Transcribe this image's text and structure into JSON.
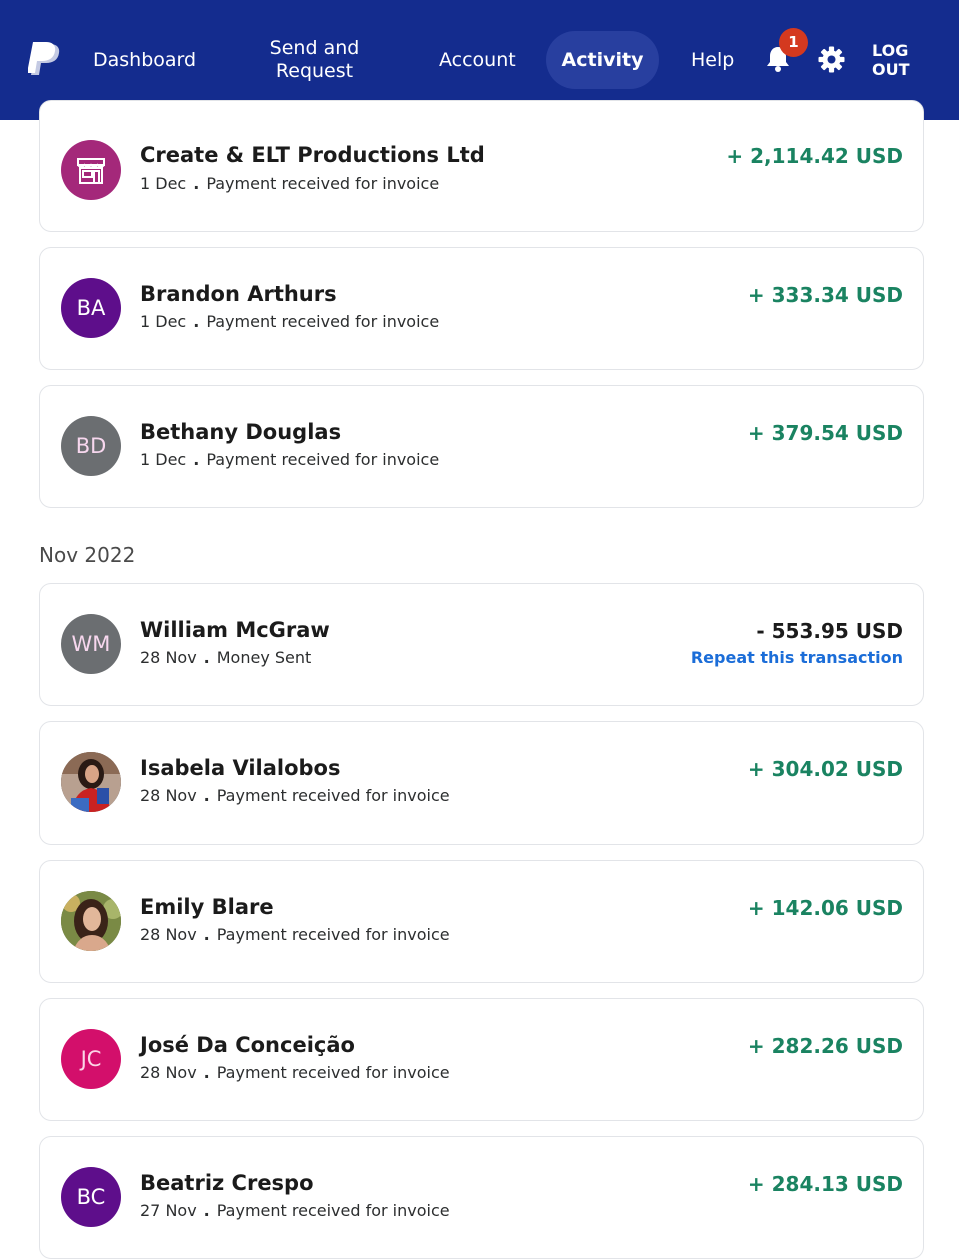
{
  "nav": {
    "dashboard": "Dashboard",
    "send_line1": "Send and",
    "send_line2": "Request",
    "account": "Account",
    "activity": "Activity",
    "help": "Help",
    "notification_count": "1",
    "logout_line1": "LOG",
    "logout_line2": "OUT"
  },
  "colors": {
    "header": "#142c8e",
    "active_tab": "#283f9f",
    "positive_amount": "#1a8361",
    "link": "#1b6dd8",
    "badge": "#d4391f"
  },
  "month_label": "Nov 2022",
  "transactions": [
    {
      "name": "Create & ELT Productions Ltd",
      "date": "1 Dec",
      "description": "Payment received for invoice",
      "amount": "+ 2,114.42 USD",
      "avatar_icon": "storefront-icon",
      "avatar_color": "#a4287a"
    },
    {
      "name": "Brandon Arthurs",
      "date": "1 Dec",
      "description": "Payment received for invoice",
      "amount": "+ 333.34 USD",
      "initials": "BA",
      "avatar_color": "#5e0e8b"
    },
    {
      "name": "Bethany Douglas",
      "date": "1 Dec",
      "description": "Payment received for invoice",
      "amount": "+ 379.54 USD",
      "initials": "BD",
      "avatar_color": "#6b6e71"
    },
    {
      "name": "William McGraw",
      "date": "28 Nov",
      "description": "Money Sent",
      "amount": "- 553.95 USD",
      "initials": "WM",
      "avatar_color": "#6b6e71",
      "action": "Repeat this transaction"
    },
    {
      "name": "Isabela Vilalobos",
      "date": "28 Nov",
      "description": "Payment received for invoice",
      "amount": "+ 304.02 USD",
      "avatar_icon": "profile-photo"
    },
    {
      "name": "Emily Blare",
      "date": "28 Nov",
      "description": "Payment received for invoice",
      "amount": "+ 142.06 USD",
      "avatar_icon": "profile-photo"
    },
    {
      "name": "José Da Conceição",
      "date": "28 Nov",
      "description": "Payment received for invoice",
      "amount": "+ 282.26 USD",
      "initials": "JC",
      "avatar_color": "#d30f6b"
    },
    {
      "name": "Beatriz Crespo",
      "date": "27 Nov",
      "description": "Payment received for invoice",
      "amount": "+ 284.13 USD",
      "initials": "BC",
      "avatar_color": "#5e0e8b"
    }
  ]
}
